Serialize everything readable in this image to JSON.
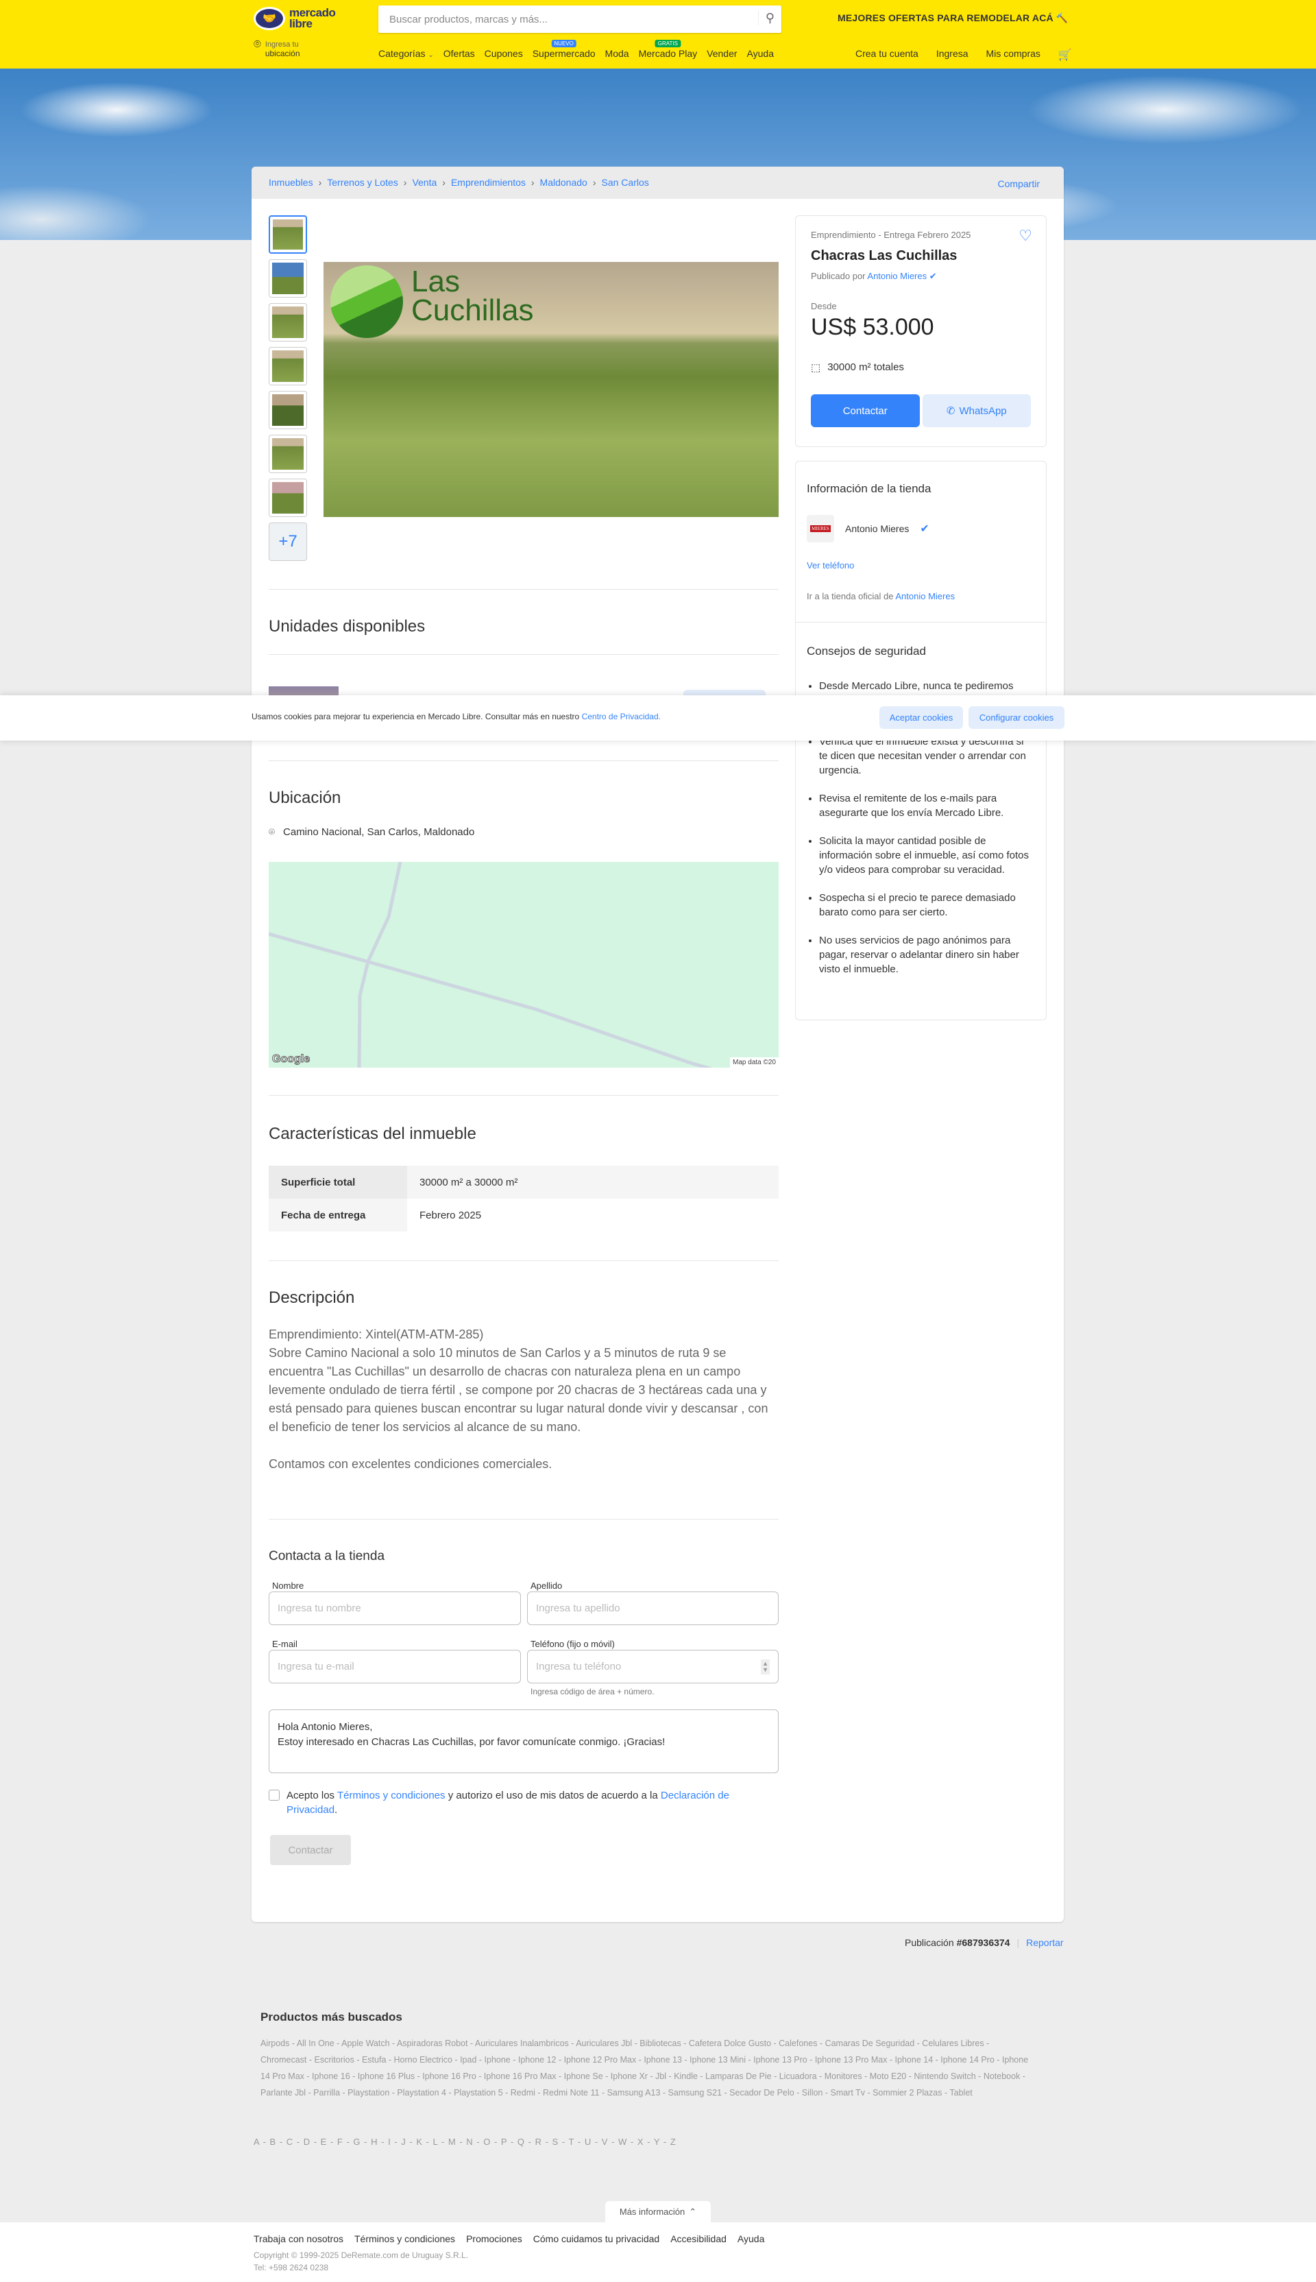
{
  "header": {
    "logo": "mercado libre",
    "search_placeholder": "Buscar productos, marcas y más...",
    "promo": "MEJORES OFERTAS PARA REMODELAR ACÁ",
    "location_line1": "Ingresa tu",
    "location_line2": "ubicación",
    "nav": [
      {
        "label": "Categorías"
      },
      {
        "label": "Ofertas"
      },
      {
        "label": "Cupones"
      },
      {
        "label": "Supermercado",
        "badge": "NUEVO"
      },
      {
        "label": "Moda"
      },
      {
        "label": "Mercado Play",
        "badge": "GRATIS"
      },
      {
        "label": "Vender"
      },
      {
        "label": "Ayuda"
      }
    ],
    "account": [
      "Crea tu cuenta",
      "Ingresa",
      "Mis compras"
    ],
    "colors": {
      "brand": "#ffe600",
      "accent": "#3483fa"
    }
  },
  "breadcrumb": [
    "Inmuebles",
    "Terrenos y Lotes",
    "Venta",
    "Emprendimientos",
    "Maldonado",
    "San Carlos"
  ],
  "share": "Compartir",
  "gallery": {
    "more": "+7",
    "logo_line1": "Las",
    "logo_line2": "Cuchillas"
  },
  "summary": {
    "subtitle": "Emprendimiento - Entrega Febrero 2025",
    "title": "Chacras Las Cuchillas",
    "published_by": "Publicado por",
    "seller": "Antonio Mieres",
    "price_label": "Desde",
    "price": "US$ 53.000",
    "area": "30000 m² totales",
    "contact": "Contactar",
    "whatsapp": "WhatsApp"
  },
  "store": {
    "title": "Información de la tienda",
    "logo": "MIERES",
    "name": "Antonio Mieres",
    "phone": "Ver teléfono",
    "official_prefix": "Ir a la tienda oficial de",
    "official_link": "Antonio Mieres"
  },
  "safety": {
    "title": "Consejos de seguridad",
    "tips": [
      "Desde Mercado Libre, nunca te pediremos",
      "Verifica que el inmueble exista y desconfía si te dicen que necesitan vender o arrendar con urgencia.",
      "Revisa el remitente de los e-mails para asegurarte que los envía Mercado Libre.",
      "Solicita la mayor cantidad posible de información sobre el inmueble, así como fotos y/o videos para comprobar su veracidad.",
      "Sospecha si el precio te parece demasiado barato como para ser cierto.",
      "No uses servicios de pago anónimos para pagar, reservar o adelantar dinero sin haber visto el inmueble."
    ]
  },
  "units": {
    "title": "Unidades disponibles"
  },
  "cookie": {
    "text": "Usamos cookies para mejorar tu experiencia en Mercado Libre. Consultar más en nuestro",
    "link": "Centro de Privacidad.",
    "accept": "Aceptar cookies",
    "configure": "Configurar cookies"
  },
  "location": {
    "title": "Ubicación",
    "address": "Camino Nacional, San Carlos, Maldonado",
    "map_brand": "Google",
    "map_data": "Map data ©20"
  },
  "features": {
    "title": "Características del inmueble",
    "rows": [
      {
        "key": "Superficie total",
        "value": "30000 m² a 30000 m²"
      },
      {
        "key": "Fecha de entrega",
        "value": "Febrero 2025"
      }
    ]
  },
  "description": {
    "title": "Descripción",
    "text": "Emprendimiento: Xintel(ATM-ATM-285)\nSobre Camino Nacional a solo 10 minutos de San Carlos y a 5 minutos de ruta 9 se encuentra \"Las Cuchillas\" un desarrollo de chacras con naturaleza plena en un campo levemente ondulado de tierra fértil , se compone por 20 chacras de 3 hectáreas cada una y está pensado para quienes buscan encontrar su lugar natural donde vivir y descansar , con el beneficio de tener los servicios al alcance de su mano.\n\nContamos con excelentes condiciones comerciales."
  },
  "contact_form": {
    "title": "Contacta a la tienda",
    "name_label": "Nombre",
    "name_ph": "Ingresa tu nombre",
    "last_label": "Apellido",
    "last_ph": "Ingresa tu apellido",
    "email_label": "E-mail",
    "email_ph": "Ingresa tu e-mail",
    "phone_label": "Teléfono (fijo o móvil)",
    "phone_ph": "Ingresa tu teléfono",
    "phone_hint": "Ingresa código de área + número.",
    "message": "Hola Antonio Mieres,\nEstoy interesado en Chacras Las Cuchillas, por favor comunícate conmigo. ¡Gracias!",
    "terms_prefix": "Acepto los",
    "terms_link": "Términos y condiciones",
    "terms_mid": "y autorizo el uso de mis datos de acuerdo a la",
    "privacy_link": "Declaración de Privacidad",
    "submit": "Contactar"
  },
  "publication": {
    "label": "Publicación",
    "id": "#687936374",
    "report": "Reportar"
  },
  "most_searched": {
    "title": "Productos más buscados",
    "items": [
      "Airpods",
      "All In One",
      "Apple Watch",
      "Aspiradoras Robot",
      "Auriculares Inalambricos",
      "Auriculares Jbl",
      "Bibliotecas",
      "Cafetera Dolce Gusto",
      "Calefones",
      "Camaras De Seguridad",
      "Celulares Libres",
      "Chromecast",
      "Escritorios",
      "Estufa",
      "Horno Electrico",
      "Ipad",
      "Iphone",
      "Iphone 12",
      "Iphone 12 Pro Max",
      "Iphone 13",
      "Iphone 13 Mini",
      "Iphone 13 Pro",
      "Iphone 13 Pro Max",
      "Iphone 14",
      "Iphone 14 Pro",
      "Iphone 14 Pro Max",
      "Iphone 16",
      "Iphone 16 Plus",
      "Iphone 16 Pro",
      "Iphone 16 Pro Max",
      "Iphone Se",
      "Iphone Xr",
      "Jbl",
      "Kindle",
      "Lamparas De Pie",
      "Licuadora",
      "Monitores",
      "Moto E20",
      "Nintendo Switch",
      "Notebook",
      "Parlante Jbl",
      "Parrilla",
      "Playstation",
      "Playstation 4",
      "Playstation 5",
      "Redmi",
      "Redmi Note 11",
      "Samsung A13",
      "Samsung S21",
      "Secador De Pelo",
      "Sillon",
      "Smart Tv",
      "Sommier 2 Plazas",
      "Tablet"
    ]
  },
  "alphabet": [
    "A",
    "B",
    "C",
    "D",
    "E",
    "F",
    "G",
    "H",
    "I",
    "J",
    "K",
    "L",
    "M",
    "N",
    "O",
    "P",
    "Q",
    "R",
    "S",
    "T",
    "U",
    "V",
    "W",
    "X",
    "Y",
    "Z"
  ],
  "footer": {
    "more_info": "Más información",
    "links": [
      "Trabaja con nosotros",
      "Términos y condiciones",
      "Promociones",
      "Cómo cuidamos tu privacidad",
      "Accesibilidad",
      "Ayuda"
    ],
    "copyright": "Copyright © 1999-2025 DeRemate.com de Uruguay S.R.L.",
    "tel": "Tel: +598 2624 0238"
  }
}
